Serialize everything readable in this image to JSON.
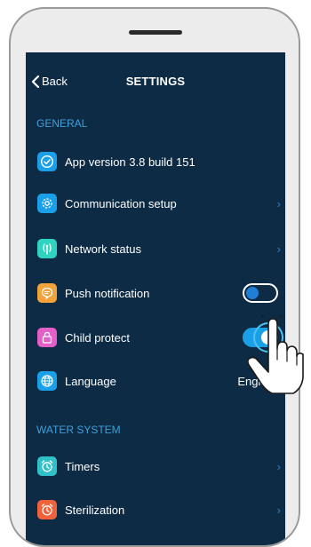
{
  "header": {
    "back_label": "Back",
    "title": "SETTINGS"
  },
  "sections": {
    "general": "GENERAL",
    "water_system": "WATER SYSTEM"
  },
  "rows": {
    "app_version": {
      "label": "App version 3.8 build 151",
      "icon": "check-circle-icon",
      "color": "#1aa0e8"
    },
    "communication": {
      "label": "Communication setup",
      "icon": "gear-icon",
      "color": "#1aa0e8"
    },
    "network": {
      "label": "Network status",
      "icon": "antenna-icon",
      "color": "#2fd3c0"
    },
    "push": {
      "label": "Push notification",
      "icon": "chat-bubble-icon",
      "color": "#f2a23a",
      "enabled": false
    },
    "child": {
      "label": "Child protect",
      "icon": "lock-icon",
      "color": "#e45fc8",
      "enabled": true
    },
    "language": {
      "label": "Language",
      "icon": "globe-icon",
      "color": "#1aa0e8",
      "value": "English"
    },
    "timers": {
      "label": "Timers",
      "icon": "alarm-clock-icon",
      "color": "#2fc0c8"
    },
    "sterilization": {
      "label": "Sterilization",
      "icon": "alarm-clock-icon",
      "color": "#f0623a"
    }
  },
  "chevron": "›",
  "colors": {
    "background": "#0d2b44",
    "accent": "#3fa0dc",
    "toggle_on": "#1aa0e8"
  }
}
